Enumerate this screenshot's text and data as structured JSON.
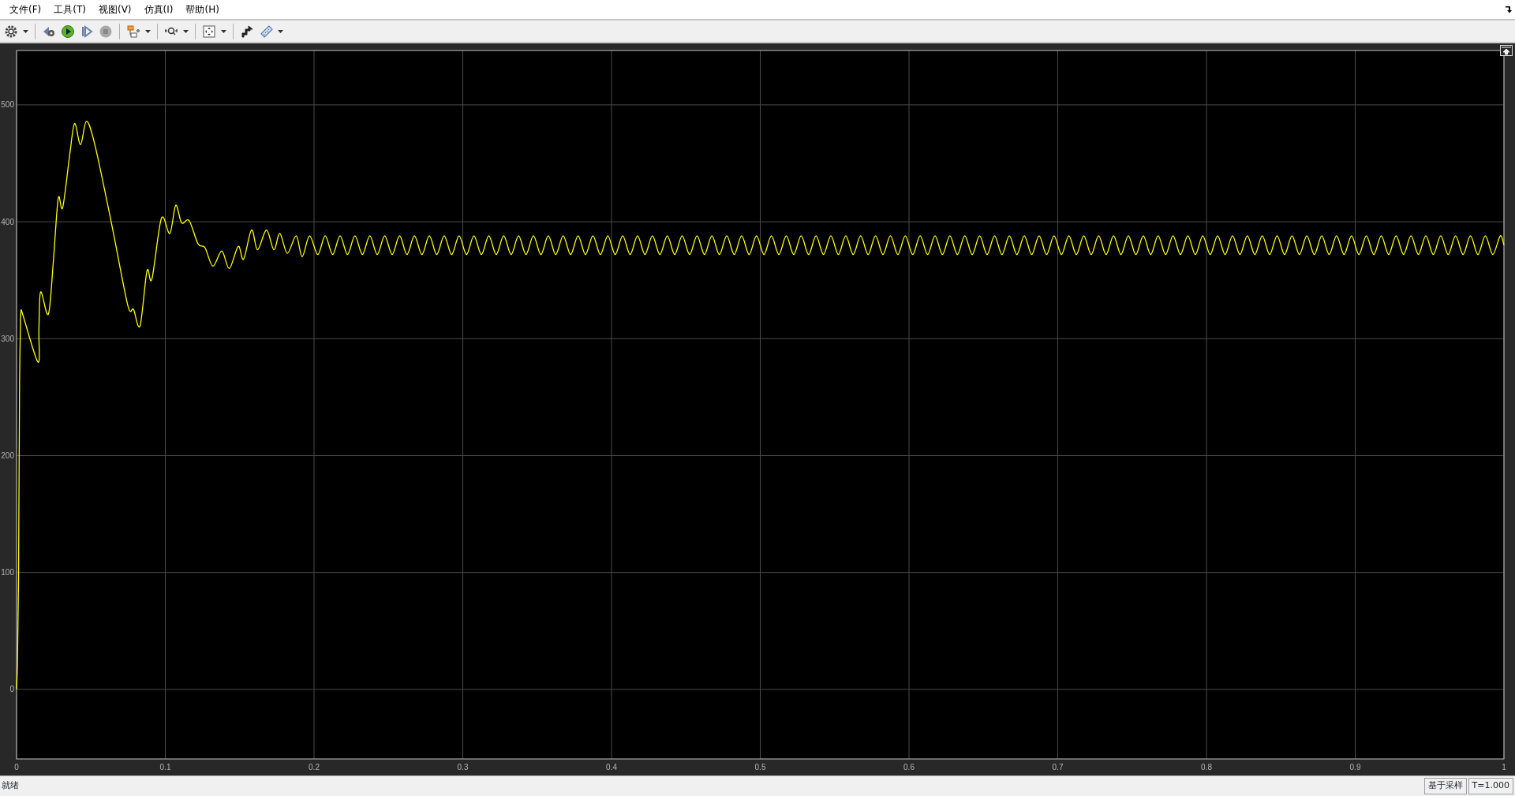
{
  "menu": [
    {
      "label": "文件(F)"
    },
    {
      "label": "工具(T)"
    },
    {
      "label": "视图(V)"
    },
    {
      "label": "仿真(I)"
    },
    {
      "label": "帮助(H)"
    }
  ],
  "scope": {
    "chart_data": {
      "type": "line",
      "grid": true,
      "xlim": [
        0,
        1
      ],
      "ylim": [
        -59.5,
        546.5
      ],
      "xticks": [
        {
          "value": 0,
          "label": "0"
        },
        {
          "value": 0.1,
          "label": "0.1"
        },
        {
          "value": 0.2,
          "label": "0.2"
        },
        {
          "value": 0.3,
          "label": "0.3"
        },
        {
          "value": 0.4,
          "label": "0.4"
        },
        {
          "value": 0.5,
          "label": "0.5"
        },
        {
          "value": 0.6,
          "label": "0.6"
        },
        {
          "value": 0.7,
          "label": "0.7"
        },
        {
          "value": 0.8,
          "label": "0.8"
        },
        {
          "value": 0.9,
          "label": "0.9"
        },
        {
          "value": 1,
          "label": "1"
        }
      ],
      "yticks": [
        {
          "value": 0,
          "label": "0"
        },
        {
          "value": 100,
          "label": "100"
        },
        {
          "value": 200,
          "label": "200"
        },
        {
          "value": 300,
          "label": "300"
        },
        {
          "value": 400,
          "label": "400"
        },
        {
          "value": 500,
          "label": "500"
        }
      ],
      "x": [
        0,
        0.0006,
        0.0013,
        0.002,
        0.0026,
        0.003,
        0.0143,
        0.015,
        0.0162,
        0.0214,
        0.0247,
        0.028,
        0.031,
        0.0357,
        0.039,
        0.043,
        0.047,
        0.0526,
        0.0636,
        0.0747,
        0.0786,
        0.083,
        0.0877,
        0.091,
        0.0974,
        0.103,
        0.107,
        0.111,
        0.116,
        0.122,
        0.1266,
        0.132,
        0.138,
        0.143,
        0.149,
        0.1526,
        0.158,
        0.162,
        0.168,
        0.173,
        0.177,
        0.182,
        0.188,
        0.192,
        0.197,
        0.2025,
        0.2075,
        0.2125,
        0.2175,
        0.2225,
        0.2275,
        0.2325,
        0.2375,
        0.2425,
        0.2475,
        0.2525,
        0.2575,
        0.2625,
        0.2675,
        0.2725,
        0.2775,
        0.2825,
        0.2875,
        0.2925,
        0.2975,
        0.3025,
        0.3075,
        0.3125,
        0.3175,
        0.3225,
        0.3275,
        0.3325,
        0.3375,
        0.3425,
        0.3475,
        0.3525,
        0.3575,
        0.3625,
        0.3675,
        0.3725,
        0.3775,
        0.3825,
        0.3875,
        0.3925,
        0.3975,
        0.4025,
        0.4075,
        0.4125,
        0.4175,
        0.4225,
        0.4275,
        0.4325,
        0.4375,
        0.4425,
        0.4475,
        0.4525,
        0.4575,
        0.4625,
        0.4675,
        0.4725,
        0.4775,
        0.4825,
        0.4875,
        0.4925,
        0.4975,
        0.5025,
        0.5075,
        0.5125,
        0.5175,
        0.5225,
        0.5275,
        0.5325,
        0.5375,
        0.5425,
        0.5475,
        0.5525,
        0.5575,
        0.5625,
        0.5675,
        0.5725,
        0.5775,
        0.5825,
        0.5875,
        0.5925,
        0.5975,
        0.6025,
        0.6075,
        0.6125,
        0.6175,
        0.6225,
        0.6275,
        0.6325,
        0.6375,
        0.6425,
        0.6475,
        0.6525,
        0.6575,
        0.6625,
        0.6675,
        0.6725,
        0.6775,
        0.6825,
        0.6875,
        0.6925,
        0.6975,
        0.7025,
        0.7075,
        0.7125,
        0.7175,
        0.7225,
        0.7275,
        0.7325,
        0.7375,
        0.7425,
        0.7475,
        0.7525,
        0.7575,
        0.7625,
        0.7675,
        0.7725,
        0.7775,
        0.7825,
        0.7875,
        0.7925,
        0.7975,
        0.8025,
        0.8075,
        0.8125,
        0.8175,
        0.8225,
        0.8275,
        0.8325,
        0.8375,
        0.8425,
        0.8475,
        0.8525,
        0.8575,
        0.8625,
        0.8675,
        0.8725,
        0.8775,
        0.8825,
        0.8875,
        0.8925,
        0.8975,
        0.9025,
        0.9075,
        0.9125,
        0.9175,
        0.9225,
        0.9275,
        0.9325,
        0.9375,
        0.9425,
        0.9475,
        0.9525,
        0.9575,
        0.9625,
        0.9675,
        0.9725,
        0.9775,
        0.9825,
        0.9875,
        0.9925,
        0.9975,
        1
      ],
      "series": [
        {
          "color": "#ffff00",
          "values": [
            0,
            20,
            94,
            263,
            317,
            325,
            280,
            308,
            340,
            321,
            366,
            420,
            412,
            457,
            484,
            466,
            486,
            466,
            400,
            329,
            325,
            311,
            358,
            351,
            403,
            390,
            414,
            399,
            401,
            381,
            378,
            362,
            375,
            360,
            379,
            368,
            393,
            376,
            393,
            376,
            390,
            373,
            388,
            370,
            388,
            372,
            388,
            372,
            388,
            372,
            388,
            372,
            388,
            372,
            388,
            372,
            388,
            372,
            388,
            372,
            388,
            372,
            388,
            372,
            388,
            372,
            388,
            372,
            388,
            372,
            388,
            372,
            388,
            372,
            388,
            372,
            388,
            372,
            388,
            372,
            388,
            372,
            388,
            372,
            388,
            372,
            388,
            372,
            388,
            372,
            388,
            372,
            388,
            372,
            388,
            372,
            388,
            372,
            388,
            372,
            388,
            372,
            388,
            372,
            388,
            372,
            388,
            372,
            388,
            372,
            388,
            372,
            388,
            372,
            388,
            372,
            388,
            372,
            388,
            372,
            388,
            372,
            388,
            372,
            388,
            372,
            388,
            372,
            388,
            372,
            388,
            372,
            388,
            372,
            388,
            372,
            388,
            372,
            388,
            372,
            388,
            372,
            388,
            372,
            388,
            372,
            388,
            372,
            388,
            372,
            388,
            372,
            388,
            372,
            388,
            372,
            388,
            372,
            388,
            372,
            388,
            372,
            388,
            372,
            388,
            372,
            388,
            372,
            388,
            372,
            388,
            372,
            388,
            372,
            388,
            372,
            388,
            372,
            388,
            372,
            388,
            372,
            388,
            372,
            388,
            372,
            388,
            372,
            388,
            372,
            388,
            372,
            388,
            372,
            388,
            372,
            388,
            372,
            388,
            372,
            388,
            372,
            388,
            372,
            388,
            380
          ]
        }
      ]
    }
  },
  "status_bar": {
    "text": "就绪",
    "mode": "基于采样",
    "time": "T=1.000"
  }
}
